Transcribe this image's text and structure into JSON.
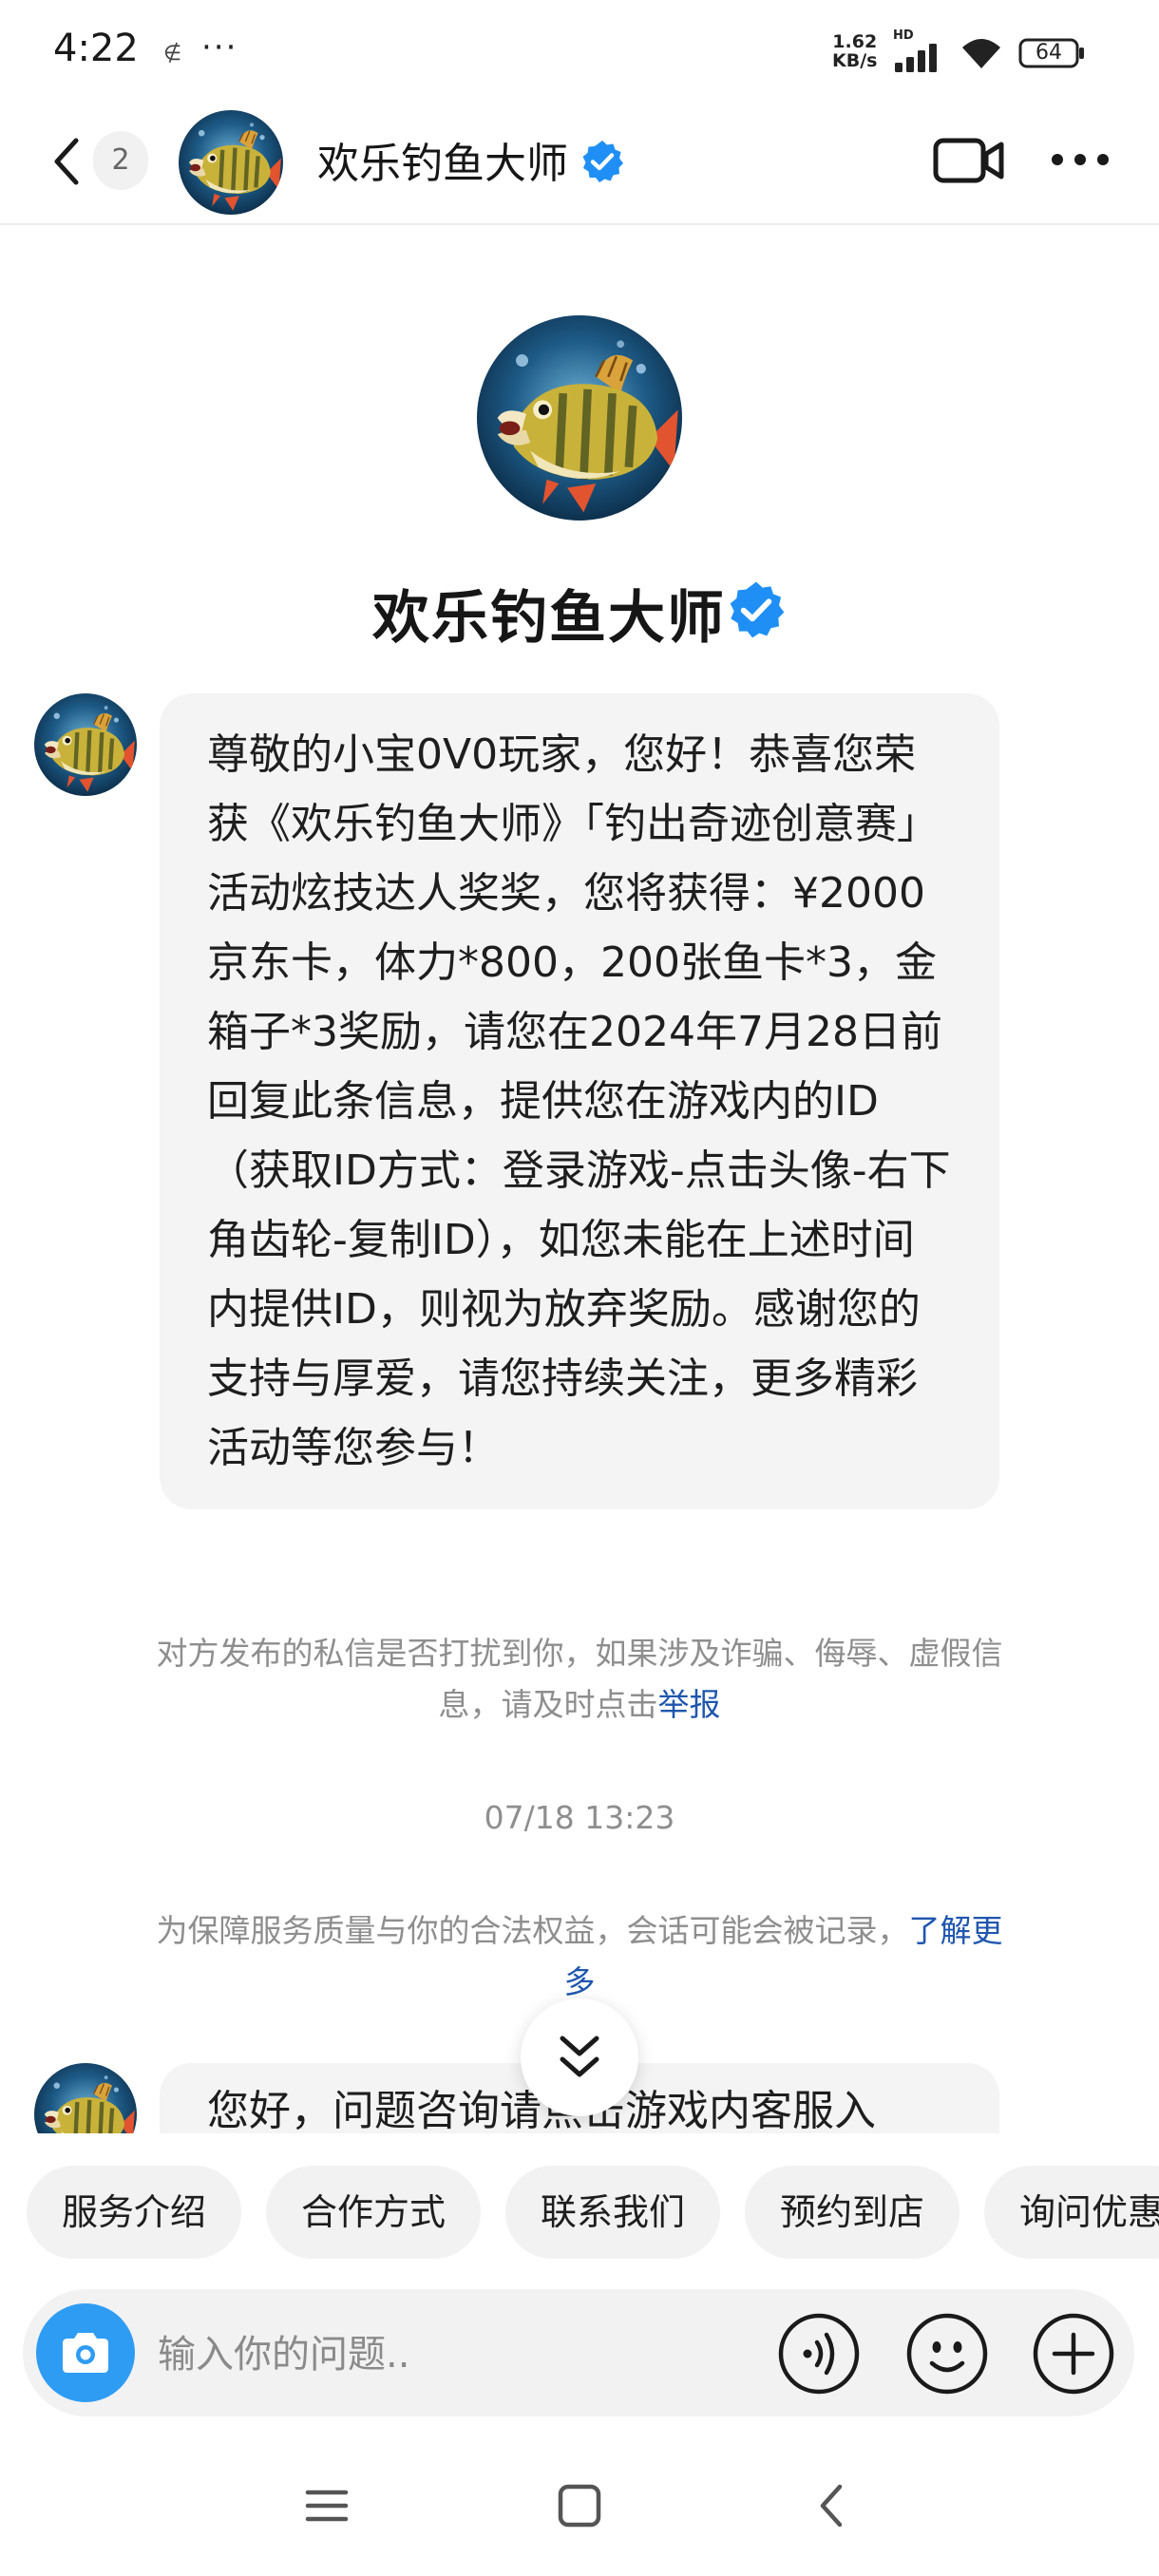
{
  "status_bar": {
    "time": "4:22",
    "sim_icon": "∉",
    "dots": "···",
    "net_speed_value": "1.62",
    "net_speed_unit": "KB/s",
    "hd": "HD",
    "battery": "64"
  },
  "header": {
    "back_count": "2",
    "title": "欢乐钓鱼大师"
  },
  "profile": {
    "name": "欢乐钓鱼大师"
  },
  "messages": [
    {
      "text": "尊敬的小宝0V0玩家，您好！恭喜您荣获《欢乐钓鱼大师》「钓出奇迹创意赛」活动炫技达人奖奖，您将获得：¥2000京东卡，体力*800，200张鱼卡*3，金箱子*3奖励，请您在2024年7月28日前回复此条信息，提供您在游戏内的ID（获取ID方式：登录游戏-点击头像-右下角齿轮-复制ID），如您未能在上述时间内提供ID，则视为放弃奖励。感谢您的支持与厚爱，请您持续关注，更多精彩活动等您参与！"
    },
    {
      "text": "您好，问题咨询请点击游戏内客服入"
    }
  ],
  "notice": {
    "text": "对方发布的私信是否打扰到你，如果涉及诈骗、侮辱、虚假信息，请及时点击",
    "link": "举报"
  },
  "timestamp": "07/18 13:23",
  "record_notice": {
    "text": "为保障服务质量与你的合法权益，会话可能会被记录，",
    "link": "了解更多"
  },
  "quick_replies": [
    "服务介绍",
    "合作方式",
    "联系我们",
    "预约到店",
    "询问优惠"
  ],
  "input": {
    "placeholder": "输入你的问题.."
  },
  "colors": {
    "accent_blue": "#2f9cf4",
    "verified_blue": "#1f8ff5",
    "link_blue": "#1f56ae",
    "bubble_bg": "#f4f4f4",
    "muted_text": "#8e8e8e"
  },
  "icons": {
    "back": "chevron-left-icon",
    "verified": "verified-badge-icon",
    "video": "video-call-icon",
    "more": "more-dots-icon",
    "scroll_down": "double-chevron-down-icon",
    "camera": "camera-icon",
    "voice": "voice-icon",
    "emoji": "emoji-icon",
    "add": "plus-circle-icon",
    "nav_menu": "menu-icon",
    "nav_home": "home-square-icon",
    "nav_back": "nav-back-icon"
  }
}
